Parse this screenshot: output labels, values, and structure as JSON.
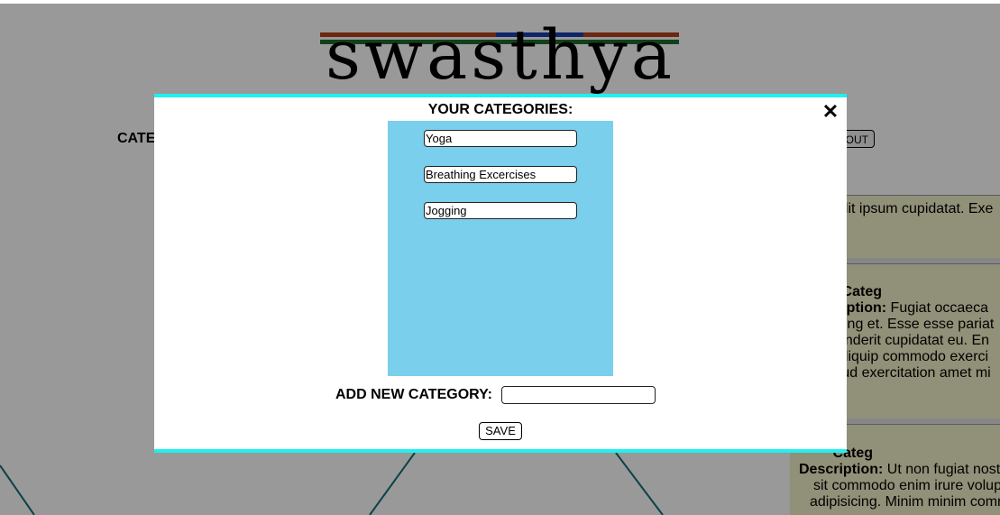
{
  "logo": {
    "text": "swasthya",
    "bar_colors": [
      "#b5421a",
      "#1a3fb0",
      "#1f6b2e"
    ]
  },
  "background": {
    "categories_label": "CATE",
    "logout_label": "OUT",
    "cards": [
      {
        "lines": [
          "elit ipsum cupidatat. Exe"
        ]
      },
      {
        "title": "Categ",
        "desc_label": "ription:",
        "lines": [
          "Fugiat occaeca",
          "cing et. Esse esse pariat",
          "enderit cupidatat eu. En",
          "aliquip commodo exerci",
          "rud exercitation amet mi"
        ]
      },
      {
        "title": "Categ",
        "desc_label": "Description:",
        "lines": [
          "Ut non fugiat nost",
          "sit commodo enim irure volup",
          "adipisicing. Minim minim comr"
        ]
      }
    ]
  },
  "modal": {
    "title": "YOUR CATEGORIES:",
    "close_glyph": "✕",
    "categories": [
      {
        "value": "Yoga"
      },
      {
        "value": "Breathing Excercises"
      },
      {
        "value": "Jogging"
      }
    ],
    "add_label": "ADD NEW CATEGORY:",
    "add_value": "",
    "save_label": "SAVE",
    "colors": {
      "accent": "#1ff0f0",
      "list_bg": "#7acfec"
    }
  }
}
